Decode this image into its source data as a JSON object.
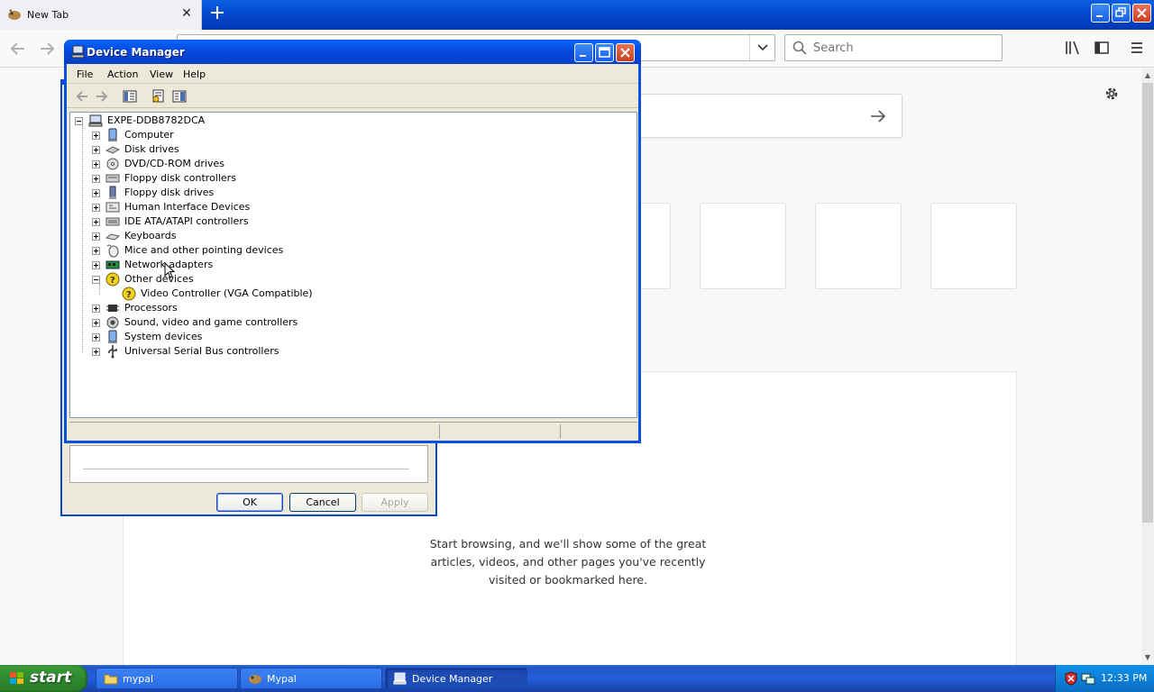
{
  "browser": {
    "tab_title": "New Tab",
    "search_placeholder": "Search"
  },
  "newtab": {
    "highlights_text": "Start browsing, and we'll show some of the great articles, videos, and other pages you've recently visited or bookmarked here."
  },
  "properties_dialog": {
    "ok_label": "OK",
    "cancel_label": "Cancel",
    "apply_label": "Apply"
  },
  "device_manager": {
    "title": "Device Manager",
    "menu": [
      "File",
      "Action",
      "View",
      "Help"
    ],
    "root": "EXPE-DDB8782DCA",
    "categories": [
      "Computer",
      "Disk drives",
      "DVD/CD-ROM drives",
      "Floppy disk controllers",
      "Floppy disk drives",
      "Human Interface Devices",
      "IDE ATA/ATAPI controllers",
      "Keyboards",
      "Mice and other pointing devices",
      "Network adapters",
      "Other devices",
      "Processors",
      "Sound, video and game controllers",
      "System devices",
      "Universal Serial Bus controllers"
    ],
    "other_devices_child": "Video Controller (VGA Compatible)"
  },
  "taskbar": {
    "start_label": "start",
    "tasks": [
      "mypal",
      "Mypal",
      "Device Manager"
    ],
    "clock": "12:33 PM"
  },
  "colors": {
    "xp_blue": "#0852df",
    "start_green": "#2f8a2f",
    "tray_blue": "#0f7fd8"
  }
}
